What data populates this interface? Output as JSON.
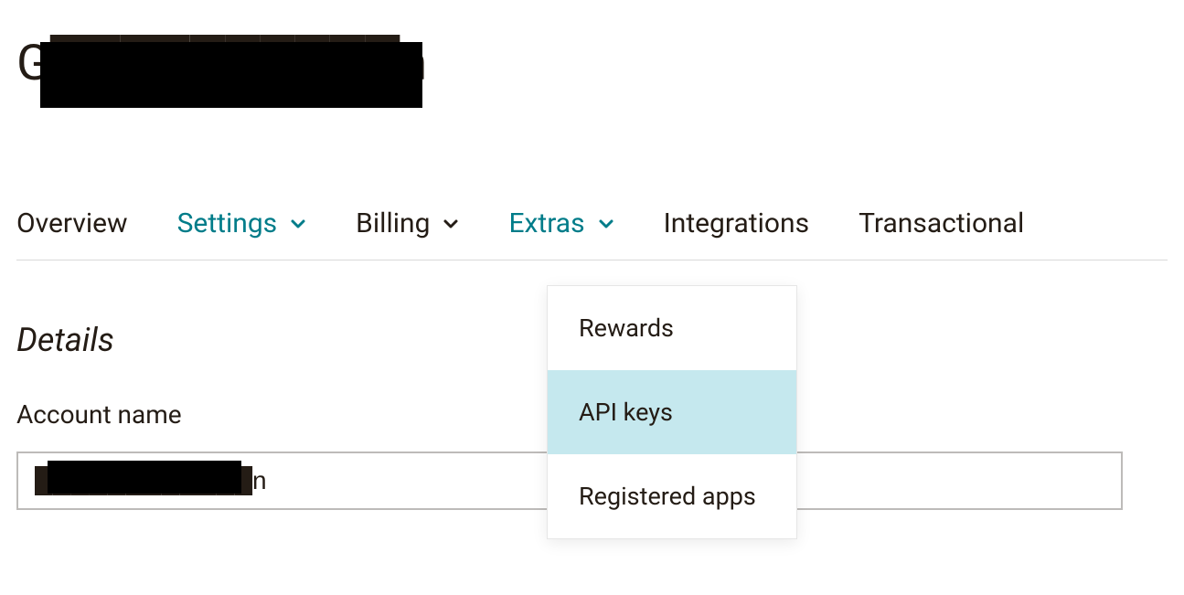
{
  "page_title": "G██████████n",
  "tabs": {
    "overview": "Overview",
    "settings": "Settings",
    "billing": "Billing",
    "extras": "Extras",
    "integrations": "Integrations",
    "transactional": "Transactional"
  },
  "extras_menu": {
    "rewards": "Rewards",
    "api_keys": "API keys",
    "registered_apps": "Registered apps"
  },
  "section_heading": "Details",
  "account_name": {
    "label": "Account name",
    "value": "████████████n"
  },
  "colors": {
    "accent": "#007c89",
    "highlight": "#c5e8ee"
  }
}
